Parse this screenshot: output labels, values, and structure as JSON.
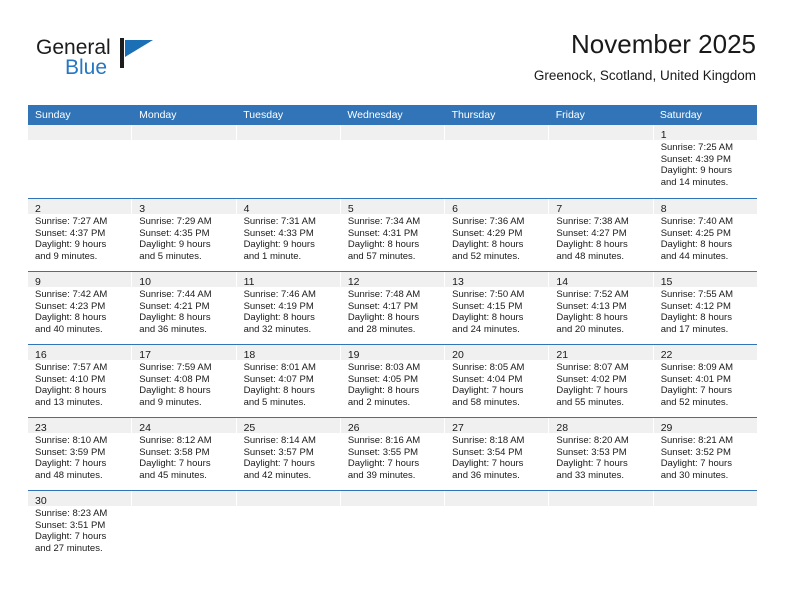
{
  "brand": {
    "name_top": "General",
    "name_bottom": "Blue",
    "accent_color": "#1a6fb5"
  },
  "header": {
    "title": "November 2025",
    "subtitle": "Greenock, Scotland, United Kingdom"
  },
  "theme": {
    "header_blue": "#3175b8",
    "daynum_band": "#f0f0f0",
    "text": "#1a1a1a"
  },
  "weekdays": [
    "Sunday",
    "Monday",
    "Tuesday",
    "Wednesday",
    "Thursday",
    "Friday",
    "Saturday"
  ],
  "weeks": [
    [
      {
        "day": "",
        "empty": true
      },
      {
        "day": "",
        "empty": true
      },
      {
        "day": "",
        "empty": true
      },
      {
        "day": "",
        "empty": true
      },
      {
        "day": "",
        "empty": true
      },
      {
        "day": "",
        "empty": true
      },
      {
        "day": "1",
        "sunrise": "Sunrise: 7:25 AM",
        "sunset": "Sunset: 4:39 PM",
        "daylight1": "Daylight: 9 hours",
        "daylight2": "and 14 minutes."
      }
    ],
    [
      {
        "day": "2",
        "sunrise": "Sunrise: 7:27 AM",
        "sunset": "Sunset: 4:37 PM",
        "daylight1": "Daylight: 9 hours",
        "daylight2": "and 9 minutes."
      },
      {
        "day": "3",
        "sunrise": "Sunrise: 7:29 AM",
        "sunset": "Sunset: 4:35 PM",
        "daylight1": "Daylight: 9 hours",
        "daylight2": "and 5 minutes."
      },
      {
        "day": "4",
        "sunrise": "Sunrise: 7:31 AM",
        "sunset": "Sunset: 4:33 PM",
        "daylight1": "Daylight: 9 hours",
        "daylight2": "and 1 minute."
      },
      {
        "day": "5",
        "sunrise": "Sunrise: 7:34 AM",
        "sunset": "Sunset: 4:31 PM",
        "daylight1": "Daylight: 8 hours",
        "daylight2": "and 57 minutes."
      },
      {
        "day": "6",
        "sunrise": "Sunrise: 7:36 AM",
        "sunset": "Sunset: 4:29 PM",
        "daylight1": "Daylight: 8 hours",
        "daylight2": "and 52 minutes."
      },
      {
        "day": "7",
        "sunrise": "Sunrise: 7:38 AM",
        "sunset": "Sunset: 4:27 PM",
        "daylight1": "Daylight: 8 hours",
        "daylight2": "and 48 minutes."
      },
      {
        "day": "8",
        "sunrise": "Sunrise: 7:40 AM",
        "sunset": "Sunset: 4:25 PM",
        "daylight1": "Daylight: 8 hours",
        "daylight2": "and 44 minutes."
      }
    ],
    [
      {
        "day": "9",
        "sunrise": "Sunrise: 7:42 AM",
        "sunset": "Sunset: 4:23 PM",
        "daylight1": "Daylight: 8 hours",
        "daylight2": "and 40 minutes."
      },
      {
        "day": "10",
        "sunrise": "Sunrise: 7:44 AM",
        "sunset": "Sunset: 4:21 PM",
        "daylight1": "Daylight: 8 hours",
        "daylight2": "and 36 minutes."
      },
      {
        "day": "11",
        "sunrise": "Sunrise: 7:46 AM",
        "sunset": "Sunset: 4:19 PM",
        "daylight1": "Daylight: 8 hours",
        "daylight2": "and 32 minutes."
      },
      {
        "day": "12",
        "sunrise": "Sunrise: 7:48 AM",
        "sunset": "Sunset: 4:17 PM",
        "daylight1": "Daylight: 8 hours",
        "daylight2": "and 28 minutes."
      },
      {
        "day": "13",
        "sunrise": "Sunrise: 7:50 AM",
        "sunset": "Sunset: 4:15 PM",
        "daylight1": "Daylight: 8 hours",
        "daylight2": "and 24 minutes."
      },
      {
        "day": "14",
        "sunrise": "Sunrise: 7:52 AM",
        "sunset": "Sunset: 4:13 PM",
        "daylight1": "Daylight: 8 hours",
        "daylight2": "and 20 minutes."
      },
      {
        "day": "15",
        "sunrise": "Sunrise: 7:55 AM",
        "sunset": "Sunset: 4:12 PM",
        "daylight1": "Daylight: 8 hours",
        "daylight2": "and 17 minutes."
      }
    ],
    [
      {
        "day": "16",
        "sunrise": "Sunrise: 7:57 AM",
        "sunset": "Sunset: 4:10 PM",
        "daylight1": "Daylight: 8 hours",
        "daylight2": "and 13 minutes."
      },
      {
        "day": "17",
        "sunrise": "Sunrise: 7:59 AM",
        "sunset": "Sunset: 4:08 PM",
        "daylight1": "Daylight: 8 hours",
        "daylight2": "and 9 minutes."
      },
      {
        "day": "18",
        "sunrise": "Sunrise: 8:01 AM",
        "sunset": "Sunset: 4:07 PM",
        "daylight1": "Daylight: 8 hours",
        "daylight2": "and 5 minutes."
      },
      {
        "day": "19",
        "sunrise": "Sunrise: 8:03 AM",
        "sunset": "Sunset: 4:05 PM",
        "daylight1": "Daylight: 8 hours",
        "daylight2": "and 2 minutes."
      },
      {
        "day": "20",
        "sunrise": "Sunrise: 8:05 AM",
        "sunset": "Sunset: 4:04 PM",
        "daylight1": "Daylight: 7 hours",
        "daylight2": "and 58 minutes."
      },
      {
        "day": "21",
        "sunrise": "Sunrise: 8:07 AM",
        "sunset": "Sunset: 4:02 PM",
        "daylight1": "Daylight: 7 hours",
        "daylight2": "and 55 minutes."
      },
      {
        "day": "22",
        "sunrise": "Sunrise: 8:09 AM",
        "sunset": "Sunset: 4:01 PM",
        "daylight1": "Daylight: 7 hours",
        "daylight2": "and 52 minutes."
      }
    ],
    [
      {
        "day": "23",
        "sunrise": "Sunrise: 8:10 AM",
        "sunset": "Sunset: 3:59 PM",
        "daylight1": "Daylight: 7 hours",
        "daylight2": "and 48 minutes."
      },
      {
        "day": "24",
        "sunrise": "Sunrise: 8:12 AM",
        "sunset": "Sunset: 3:58 PM",
        "daylight1": "Daylight: 7 hours",
        "daylight2": "and 45 minutes."
      },
      {
        "day": "25",
        "sunrise": "Sunrise: 8:14 AM",
        "sunset": "Sunset: 3:57 PM",
        "daylight1": "Daylight: 7 hours",
        "daylight2": "and 42 minutes."
      },
      {
        "day": "26",
        "sunrise": "Sunrise: 8:16 AM",
        "sunset": "Sunset: 3:55 PM",
        "daylight1": "Daylight: 7 hours",
        "daylight2": "and 39 minutes."
      },
      {
        "day": "27",
        "sunrise": "Sunrise: 8:18 AM",
        "sunset": "Sunset: 3:54 PM",
        "daylight1": "Daylight: 7 hours",
        "daylight2": "and 36 minutes."
      },
      {
        "day": "28",
        "sunrise": "Sunrise: 8:20 AM",
        "sunset": "Sunset: 3:53 PM",
        "daylight1": "Daylight: 7 hours",
        "daylight2": "and 33 minutes."
      },
      {
        "day": "29",
        "sunrise": "Sunrise: 8:21 AM",
        "sunset": "Sunset: 3:52 PM",
        "daylight1": "Daylight: 7 hours",
        "daylight2": "and 30 minutes."
      }
    ],
    [
      {
        "day": "30",
        "sunrise": "Sunrise: 8:23 AM",
        "sunset": "Sunset: 3:51 PM",
        "daylight1": "Daylight: 7 hours",
        "daylight2": "and 27 minutes."
      },
      {
        "day": "",
        "empty": true
      },
      {
        "day": "",
        "empty": true
      },
      {
        "day": "",
        "empty": true
      },
      {
        "day": "",
        "empty": true
      },
      {
        "day": "",
        "empty": true
      },
      {
        "day": "",
        "empty": true
      }
    ]
  ]
}
